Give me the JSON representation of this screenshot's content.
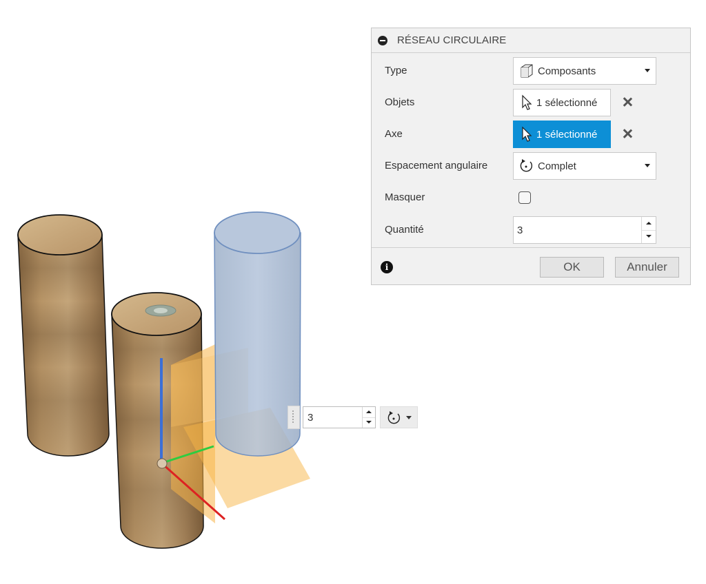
{
  "dialog": {
    "title": "RÉSEAU CIRCULAIRE",
    "rows": {
      "type": {
        "label": "Type",
        "value": "Composants"
      },
      "objects": {
        "label": "Objets",
        "value": "1 sélectionné"
      },
      "axis": {
        "label": "Axe",
        "value": "1 sélectionné"
      },
      "spacing": {
        "label": "Espacement angulaire",
        "value": "Complet"
      },
      "suppress": {
        "label": "Masquer",
        "checked": false
      },
      "quantity": {
        "label": "Quantité",
        "value": "3"
      }
    },
    "ok_label": "OK",
    "cancel_label": "Annuler"
  },
  "canvas": {
    "quantity_value": "3",
    "spacing_icon": "circular-spacing-icon"
  },
  "colors": {
    "accent_selected": "#0d8fd6",
    "dialog_bg": "#f1f1f1",
    "wood": "#b08a5c",
    "preview_blue": "#a9bbd3",
    "plane_orange": "#f7b548"
  }
}
